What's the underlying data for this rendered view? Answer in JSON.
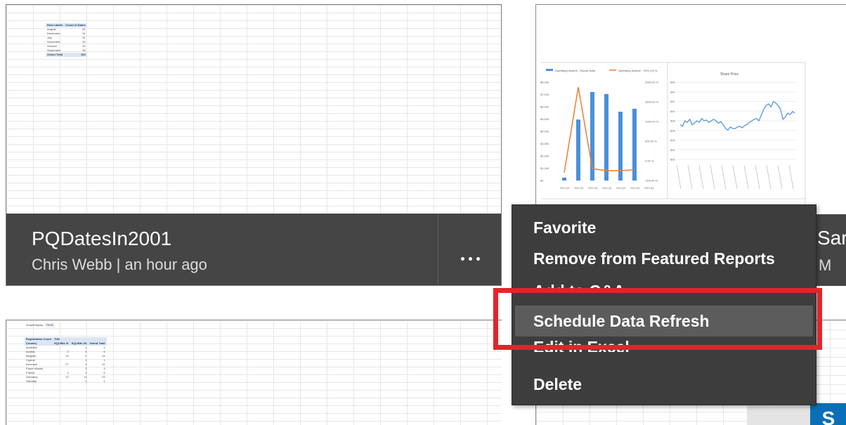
{
  "tiles": [
    {
      "title": "PQDatesIn2001",
      "meta": "Chris Webb | an hour ago",
      "thumbnail_table": {
        "headers": [
          "Row Labels",
          "Count of Dates"
        ],
        "rows": [
          [
            "August",
            "31"
          ],
          [
            "December",
            "31"
          ],
          [
            "July",
            "31"
          ],
          [
            "November",
            "30"
          ],
          [
            "October",
            "31"
          ],
          [
            "September",
            "30"
          ]
        ],
        "total": [
          "Grand Total",
          "184"
        ]
      }
    },
    {
      "title_fragment": "Sar",
      "meta_fragment": "M",
      "thumbnail_charts": {
        "left_legend": [
          "Operating Income - Report Date",
          "Operating Income - YR/1 1Q %"
        ],
        "left_yticks": [
          "$8,000",
          "$7,000",
          "$6,000",
          "$5,000",
          "$4,000",
          "$3,000",
          "$2,000",
          "$1,000",
          "$0"
        ],
        "right_yticks": [
          "$46",
          "$44",
          "$42",
          "$40",
          "$38",
          "$36",
          "$34",
          "$32",
          "$30"
        ],
        "xticks": [
          "2012 Q1",
          "2012 Q2",
          "2012 Q3",
          "2012 Q4",
          "2013 Q1",
          "2013 Q2",
          "2013 Q3"
        ],
        "right_title": "Share Price"
      }
    },
    {
      "thumbnail_table": {
        "filter": [
          "GraphDisplay",
          "TRUE"
        ],
        "header1": [
          "Registration Count",
          "Title"
        ],
        "headers": [
          "Country",
          "SQLBits IX",
          "SQLBits XII",
          "Grand Total"
        ],
        "rows": [
          [
            "Australia",
            "",
            "1",
            "1"
          ],
          [
            "Austria",
            "3",
            "3",
            "6"
          ],
          [
            "Belgium",
            "12",
            "2",
            "14"
          ],
          [
            "Cyprus",
            "",
            "1",
            "1"
          ],
          [
            "Denmark",
            "27",
            "4",
            "31"
          ],
          [
            "Faroe Islands",
            "",
            "3",
            "3"
          ],
          [
            "France",
            "2",
            "3",
            "5"
          ],
          [
            "Germany",
            "12",
            "11",
            "23"
          ],
          [
            "Gibraltar",
            "",
            "1",
            "1"
          ]
        ]
      }
    },
    {
      "badge": "S"
    }
  ],
  "context_menu": {
    "items": [
      {
        "label": "Favorite"
      },
      {
        "label": "Remove from Featured Reports"
      },
      {
        "label": "Add to Q&A"
      },
      {
        "label": "Schedule Data Refresh",
        "selected": true
      },
      {
        "label": "Edit in Excel"
      },
      {
        "label": "Delete"
      }
    ]
  },
  "colors": {
    "tile_bar": "#454545",
    "menu_bg": "#3d3d3d",
    "menu_selected": "#5c5c5c",
    "highlight": "#e0252a",
    "bar_series": "#4a90d9",
    "line_series": "#ed7d31"
  }
}
